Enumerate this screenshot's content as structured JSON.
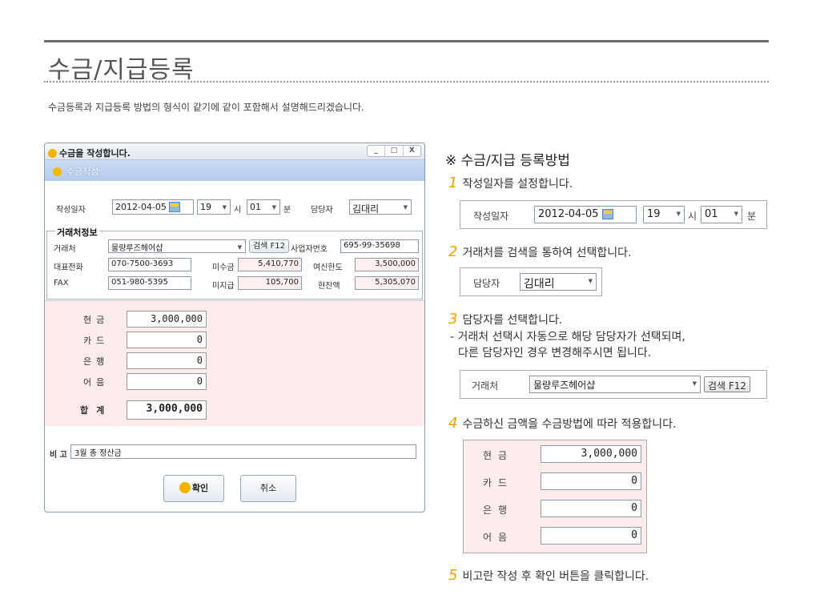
{
  "page": {
    "title": "수금/지급등록",
    "intro": "수금등록과 지급등록 방법의 형식이 같기에 같이 포함해서 설명해드리겠습니다."
  },
  "dialog": {
    "title": "수금을 작성합니다.",
    "controls": [
      "_",
      "□",
      "X"
    ],
    "subtitle": "수금작성",
    "date_label": "작성일자",
    "date_value": "2012-04-05",
    "hour_value": "19",
    "hour_unit": "시",
    "minute_value": "01",
    "minute_unit": "분",
    "manager_label": "담당자",
    "manager_value": "김대리",
    "group_title": "거래처정보",
    "client_label": "거래처",
    "client_value": "물량루즈헤어샵",
    "search_button": "검색 F12",
    "biz_no_label": "사업자번호",
    "biz_no_value": "695-99-35698",
    "rep_phone_label": "대표전화",
    "rep_phone_value": "070-7500-3693",
    "receivable_label": "미수금",
    "receivable_value": "5,410,770",
    "credit_limit_label": "여신한도",
    "credit_limit_value": "3,500,000",
    "fax_label": "FAX",
    "fax_value": "051-980-5395",
    "payable_label": "미지급",
    "payable_value": "105,700",
    "balance_label": "현잔액",
    "balance_value": "5,305,070",
    "amounts": [
      {
        "label": "현금",
        "value": "3,000,000"
      },
      {
        "label": "카드",
        "value": "0"
      },
      {
        "label": "은행",
        "value": "0"
      },
      {
        "label": "어음",
        "value": "0"
      }
    ],
    "total_label": "합계",
    "total_value": "3,000,000",
    "memo_label": "비 고",
    "memo_value": "3월 총 정산금",
    "confirm_button": "확인",
    "cancel_button": "취소"
  },
  "guide": {
    "heading": "※ 수금/지급 등록방법",
    "steps": [
      {
        "num": "1",
        "text": "작성일자를 설정합니다."
      },
      {
        "num": "2",
        "text": "거래처를 검색을 통하여 선택합니다."
      },
      {
        "num": "3",
        "text": "담당자를 선택합니다.",
        "note1": "- 거래처 선택시 자동으로 해당 담당자가  선택되며,",
        "note2": "다른 담당자인 경우 변경해주시면 됩니다."
      },
      {
        "num": "4",
        "text": "수금하신 금액을 수금방법에 따라 적용합니다."
      },
      {
        "num": "5",
        "text": "비고란 작성 후 확인 버튼을 클릭합니다."
      }
    ]
  }
}
